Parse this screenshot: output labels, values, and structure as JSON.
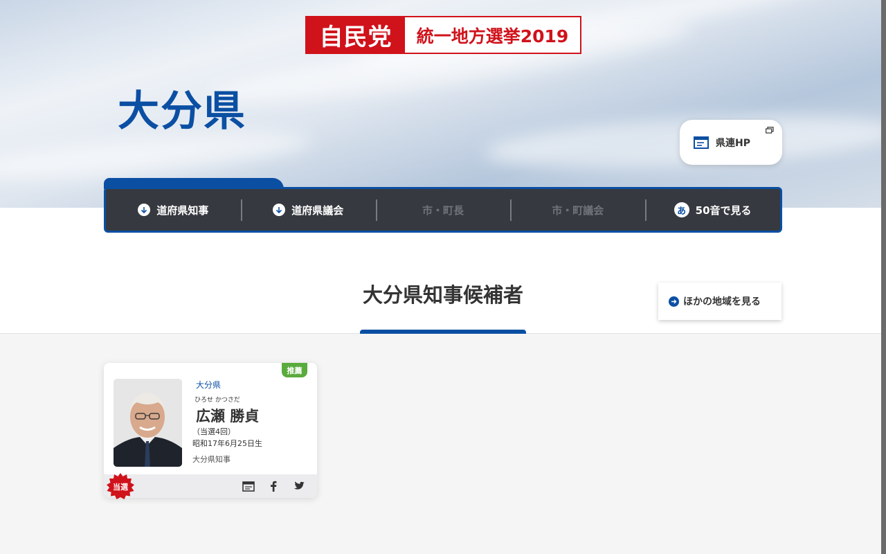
{
  "logo": {
    "party": "自民党",
    "election": "統一地方選挙2019"
  },
  "prefecture_title": "大分県",
  "hp_button": {
    "label": "県連HP",
    "icon": "browser-window-icon"
  },
  "nav": {
    "items": [
      {
        "label": "道府県知事",
        "icon": "arrow-down-circle-icon",
        "enabled": true
      },
      {
        "label": "道府県議会",
        "icon": "arrow-down-circle-icon",
        "enabled": true
      },
      {
        "label": "市・町長",
        "enabled": false
      },
      {
        "label": "市・町議会",
        "enabled": false
      },
      {
        "label": "50音で見る",
        "icon": "hiragana-a-icon",
        "icon_glyph": "あ",
        "enabled": true
      }
    ]
  },
  "section": {
    "title": "大分県知事候補者"
  },
  "other_regions_button": {
    "label": "ほかの地域を見る"
  },
  "candidates": [
    {
      "badge": "推薦",
      "region": "大分県",
      "kana": "ひろせ かつさだ",
      "name": "広瀬 勝貞",
      "terms": "（当選4回）",
      "birth": "昭和17年6月25日生",
      "position": "大分県知事",
      "result_badge": "当選",
      "links": [
        "website-icon",
        "facebook-icon",
        "twitter-icon"
      ]
    }
  ],
  "colors": {
    "brand_red": "#d0121b",
    "brand_blue": "#0b4fa3",
    "nav_bg": "#36393f",
    "badge_green": "#5aab3d"
  }
}
